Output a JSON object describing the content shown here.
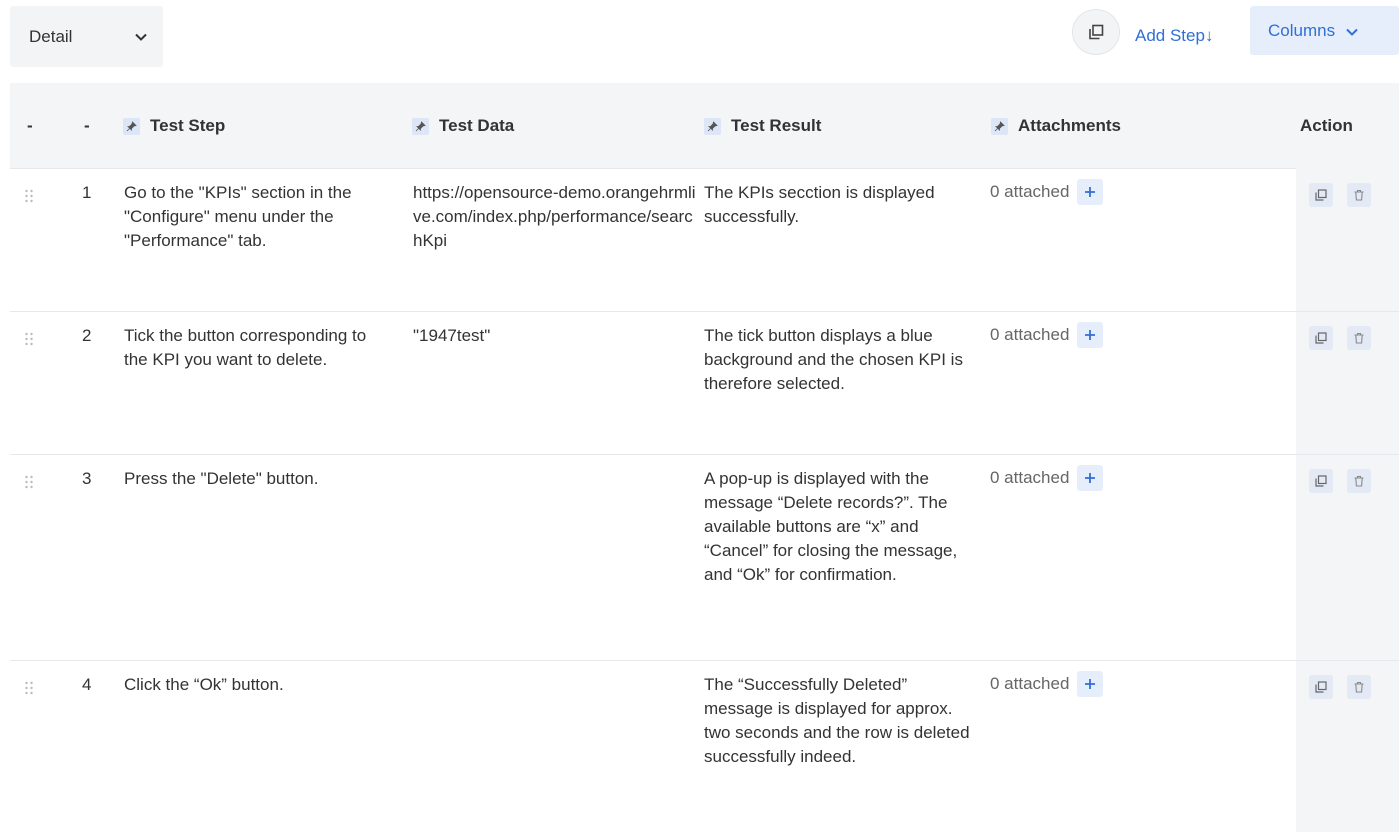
{
  "toolbar": {
    "view_label": "Detail",
    "add_step_label": "Add Step",
    "add_step_arrow": "↓",
    "columns_label": "Columns"
  },
  "table": {
    "headers": {
      "drag": "-",
      "index": "-",
      "test_step": "Test Step",
      "test_data": "Test Data",
      "test_result": "Test Result",
      "attachments": "Attachments",
      "action": "Action"
    },
    "rows": [
      {
        "index": "1",
        "test_step": "Go to the \"KPIs\" section in the \"Configure\" menu under the \"Performance\" tab.",
        "test_data": "https://opensource-demo.orangehrmlive.com/index.php/performance/searchKpi",
        "test_result": "The KPIs secction is displayed successfully.",
        "attachments": "0 attached"
      },
      {
        "index": "2",
        "test_step": "Tick the button corresponding to the KPI you want to delete.",
        "test_data": "\"1947test\"",
        "test_result": "The tick button displays a blue background and the chosen KPI is therefore selected.",
        "attachments": "0 attached"
      },
      {
        "index": "3",
        "test_step": "Press the \"Delete\" button.",
        "test_data": "",
        "test_result": "A pop-up is displayed with the message “Delete records?”. The available buttons are “x” and “Cancel” for closing the message, and “Ok” for confirmation.",
        "attachments": "0 attached"
      },
      {
        "index": "4",
        "test_step": "Click the “Ok” button.",
        "test_data": "",
        "test_result": "The “Successfully Deleted” message is displayed for approx. two seconds and the row is deleted successfully indeed.",
        "attachments": "0 attached"
      }
    ]
  },
  "colors": {
    "accent": "#2f6fd6",
    "header_bg": "#f4f5f7",
    "button_bg": "#e6eefb"
  }
}
